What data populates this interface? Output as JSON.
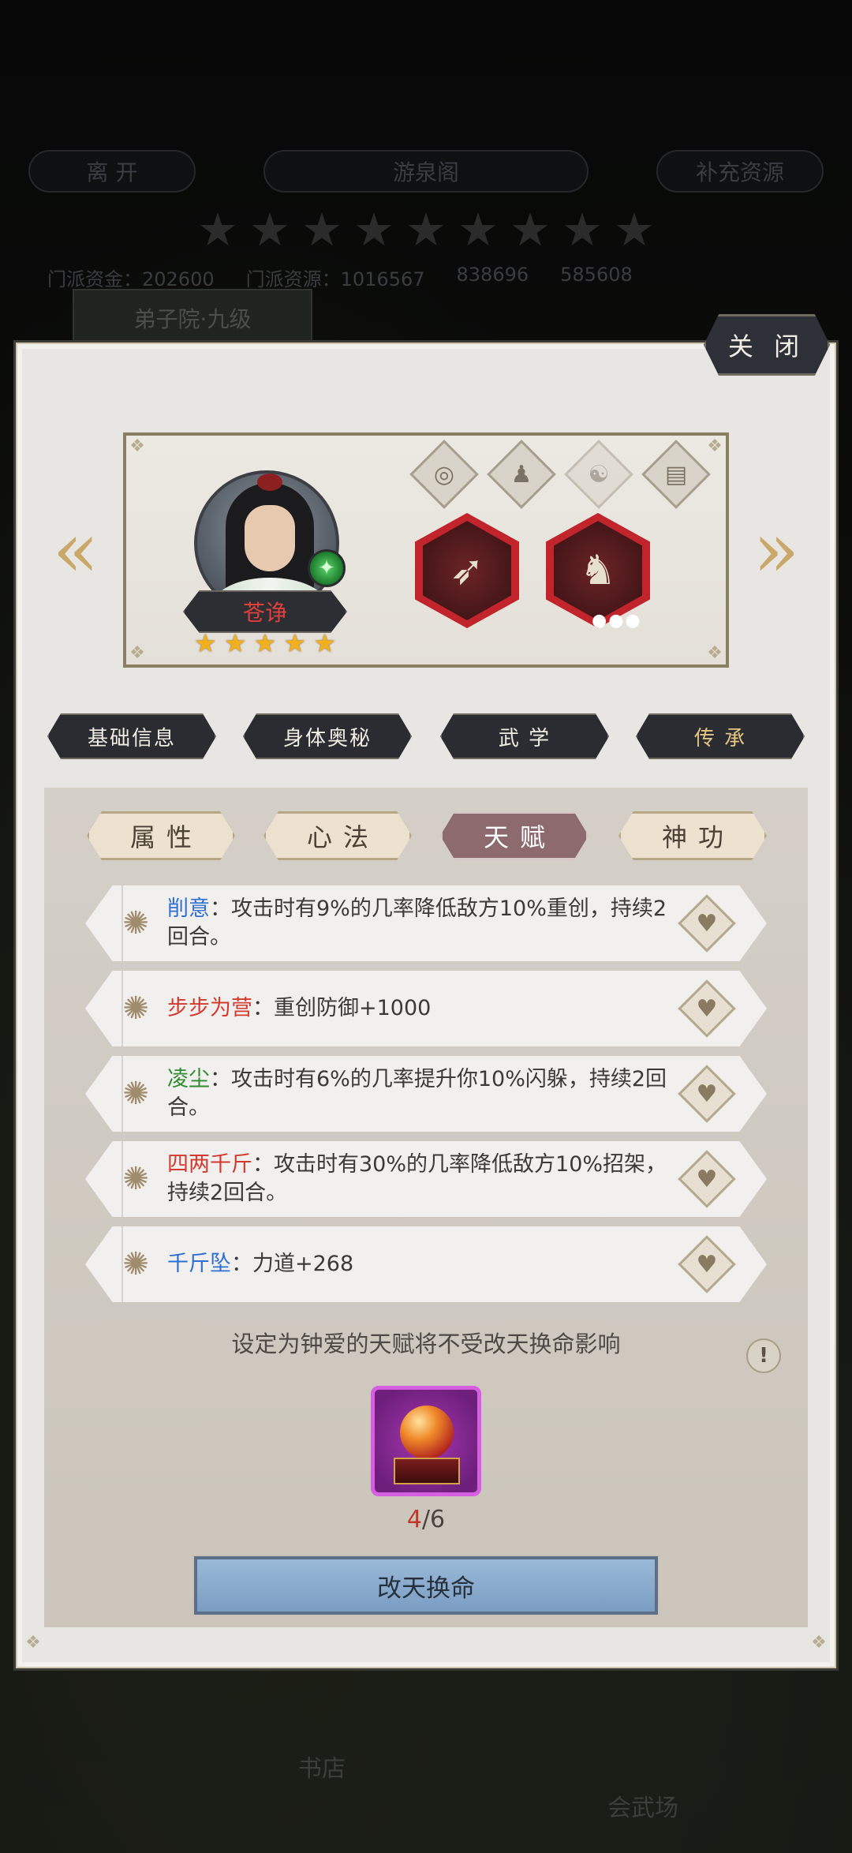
{
  "background": {
    "leave_label": "离 开",
    "location_label": "游泉阁",
    "supply_label": "补充资源",
    "sect_gold_label": "门派资金：",
    "sect_gold_value": "202600",
    "sect_resource_label": "门派资源：",
    "sect_resource_value": "1016567",
    "stat_3": "838696",
    "stat_4": "585608",
    "building_tab": "弟子院·九级",
    "bookstore_label": "书店",
    "arena_label": "会武场"
  },
  "modal": {
    "close_label": "关 闭"
  },
  "hero": {
    "name": "苍诤",
    "stars": [
      "★",
      "★",
      "★",
      "★",
      "★"
    ],
    "element_glyph": "✦",
    "prev_arrow": "«",
    "next_arrow": "»",
    "equip_dots": "●●●"
  },
  "main_tabs": [
    {
      "label": "基础信息"
    },
    {
      "label": "身体奥秘"
    },
    {
      "label": "武 学"
    },
    {
      "label": "传 承"
    }
  ],
  "sub_tabs": [
    {
      "label": "属性"
    },
    {
      "label": "心法"
    },
    {
      "label": "天赋"
    },
    {
      "label": "神功"
    }
  ],
  "talents": [
    {
      "name": "削意",
      "name_color": "#2f6fd0",
      "desc": "：攻击时有9%的几率降低敌方10%重创，持续2回合。"
    },
    {
      "name": "步步为营",
      "name_color": "#d23a2f",
      "desc": "：重创防御+1000"
    },
    {
      "name": "凌尘",
      "name_color": "#2e8b2e",
      "desc": "：攻击时有6%的几率提升你10%闪躲，持续2回合。"
    },
    {
      "name": "四两千斤",
      "name_color": "#d23a2f",
      "desc": "：攻击时有30%的几率降低敌方10%招架，持续2回合。"
    },
    {
      "name": "千斤坠",
      "name_color": "#2f6fd0",
      "desc": "：力道+268"
    }
  ],
  "note": "设定为钟爱的天赋将不受改天换命影响",
  "info_glyph": "!",
  "item": {
    "count_current": "4",
    "count_total": "/6"
  },
  "action_button": "改天换命"
}
